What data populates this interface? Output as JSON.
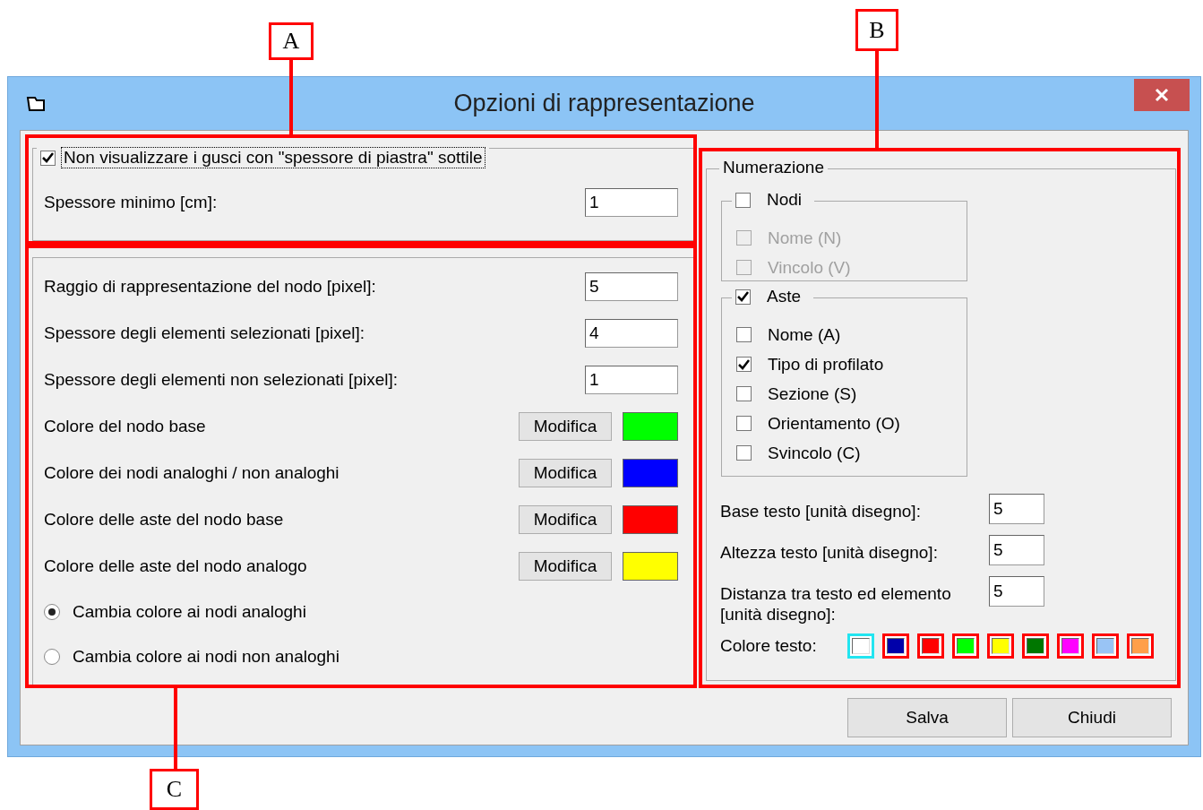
{
  "window": {
    "title": "Opzioni di rappresentazione"
  },
  "annotations": [
    {
      "label": "A"
    },
    {
      "label": "B"
    },
    {
      "label": "C"
    }
  ],
  "thin_shells": {
    "checkbox": {
      "label": "Non visualizzare i gusci con \"spessore di piastra\" sottile",
      "checked": true
    },
    "field": {
      "label": "Spessore minimo [cm]:",
      "value": "1"
    }
  },
  "display": {
    "fields": [
      {
        "label": "Raggio di rappresentazione del nodo [pixel]:",
        "value": "5"
      },
      {
        "label": "Spessore degli elementi selezionati [pixel]:",
        "value": "4"
      },
      {
        "label": "Spessore degli elementi non selezionati [pixel]:",
        "value": "1"
      }
    ],
    "colors": [
      {
        "label": "Colore del nodo base",
        "button": "Modifica",
        "color": "#00ff00"
      },
      {
        "label": "Colore dei nodi analoghi /  non analoghi",
        "button": "Modifica",
        "color": "#0000ff"
      },
      {
        "label": "Colore delle aste del nodo base",
        "button": "Modifica",
        "color": "#ff0000"
      },
      {
        "label": "Colore delle aste del nodo analogo",
        "button": "Modifica",
        "color": "#ffff00"
      }
    ],
    "radios": [
      {
        "label": "Cambia colore ai nodi analoghi",
        "selected": true
      },
      {
        "label": "Cambia colore ai nodi non analoghi",
        "selected": false
      }
    ]
  },
  "numbering": {
    "title": "Numerazione",
    "groups": [
      {
        "label": "Nodi",
        "checked": false,
        "items": [
          {
            "label": "Nome (N)",
            "checked": false,
            "disabled": true
          },
          {
            "label": "Vincolo (V)",
            "checked": false,
            "disabled": true
          }
        ]
      },
      {
        "label": "Aste",
        "checked": true,
        "items": [
          {
            "label": "Nome (A)",
            "checked": false,
            "disabled": false
          },
          {
            "label": "Tipo di profilato",
            "checked": true,
            "disabled": false
          },
          {
            "label": "Sezione (S)",
            "checked": false,
            "disabled": false
          },
          {
            "label": "Orientamento (O)",
            "checked": false,
            "disabled": false
          },
          {
            "label": "Svincolo (C)",
            "checked": false,
            "disabled": false
          }
        ]
      }
    ],
    "fields": [
      {
        "label": "Base testo [unità disegno]:",
        "value": "5"
      },
      {
        "label": "Altezza testo [unità disegno]:",
        "value": "5"
      },
      {
        "label": "Distanza tra testo ed elemento [unità disegno]:",
        "value": "5"
      }
    ],
    "text_color": {
      "label": "Colore testo:",
      "swatches": [
        {
          "color": "#ffffff",
          "selected": true
        },
        {
          "color": "#0000aa",
          "selected": false
        },
        {
          "color": "#ff0000",
          "selected": false
        },
        {
          "color": "#00ff00",
          "selected": false
        },
        {
          "color": "#ffff00",
          "selected": false
        },
        {
          "color": "#007700",
          "selected": false
        },
        {
          "color": "#ff00ff",
          "selected": false
        },
        {
          "color": "#99c4f5",
          "selected": false
        },
        {
          "color": "#ff9f4a",
          "selected": false
        }
      ]
    }
  },
  "buttons": [
    "Salva",
    "Chiudi"
  ]
}
